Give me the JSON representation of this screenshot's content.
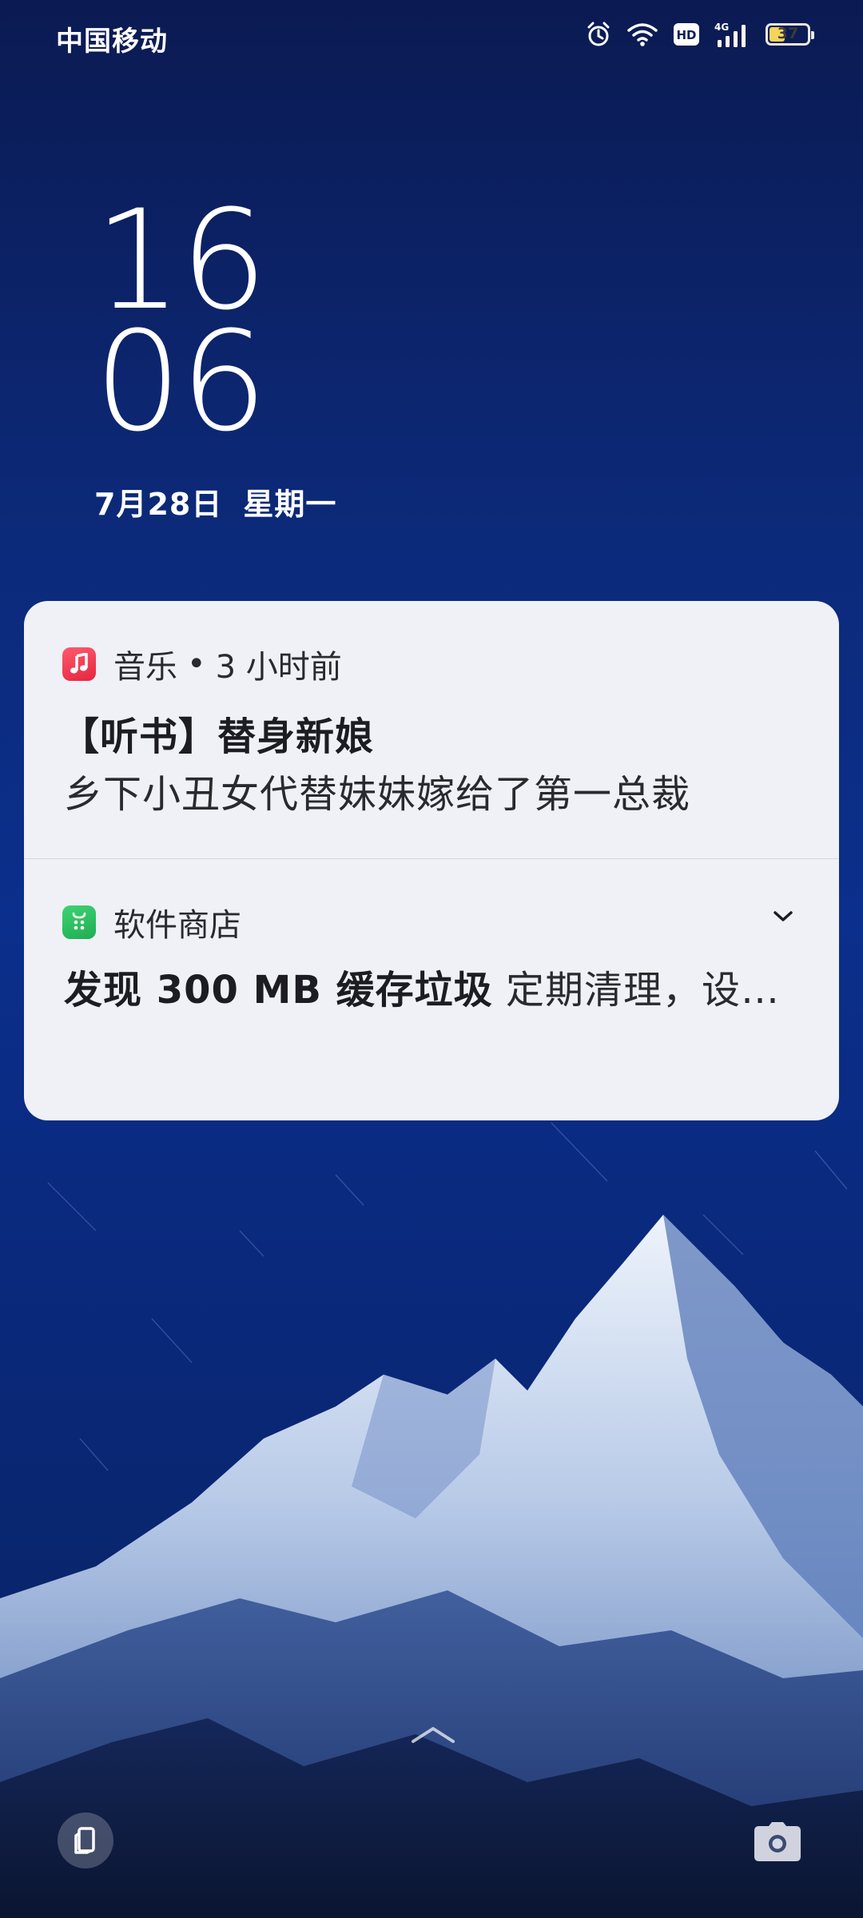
{
  "status_bar": {
    "carrier": "中国移动",
    "icons": [
      "alarm-icon",
      "wifi-icon",
      "hd-icon",
      "4g-signal-icon",
      "battery-icon"
    ],
    "hd_label": "HD",
    "network_label": "4G",
    "battery_level": "37"
  },
  "lock_screen": {
    "clock_hour": "16",
    "clock_minute": "06",
    "date": "7月28日",
    "weekday": "星期一"
  },
  "notifications": [
    {
      "app_name": "音乐",
      "separator": "•",
      "time": "3 小时前",
      "title": "【听书】替身新娘",
      "body": "乡下小丑女代替妹妹嫁给了第一总裁",
      "icon": "music-note-icon",
      "accent": "#f0344b"
    },
    {
      "app_name": "软件商店",
      "body_bold": "发现 300 MB 缓存垃圾",
      "body_rest": " 定期清理，设…",
      "icon": "app-store-icon",
      "accent": "#26c05c"
    }
  ],
  "bottom_bar": {
    "left_icon": "device-clone-icon",
    "center_icon": "swipe-up-chevron-icon",
    "right_icon": "camera-icon"
  }
}
